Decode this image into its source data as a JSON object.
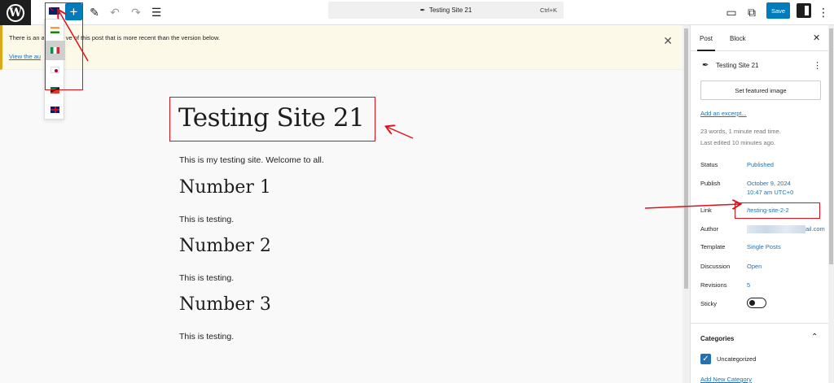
{
  "topbar": {
    "command_title": "Testing Site 21",
    "command_shortcut": "Ctrl+K",
    "save_label": "Save",
    "add_label": "+"
  },
  "notice": {
    "text_before": "There is an a",
    "text_after": "ve of this post that is more recent than the version below.",
    "link_text": "View the au"
  },
  "post": {
    "title": "Testing Site 21",
    "intro": "This is my testing site. Welcome to all.",
    "headings": [
      "Number 1",
      "Number 2",
      "Number 3"
    ],
    "paragraphs": [
      "This is testing.",
      "This is testing.",
      "This is testing."
    ]
  },
  "sidebar": {
    "tab_post": "Post",
    "tab_block": "Block",
    "post_title": "Testing Site 21",
    "featured_image_label": "Set featured image",
    "excerpt_link": "Add an excerpt...",
    "read_time": "23 words, 1 minute read time.",
    "last_edited": "Last edited 10 minutes ago.",
    "status_label": "Status",
    "status_value": "Published",
    "publish_label": "Publish",
    "publish_date": "October 9, 2024",
    "publish_time": "10:47 am UTC+0",
    "link_label": "Link",
    "link_value": "/testing-site-2-2",
    "author_label": "Author",
    "author_suffix": "ail.com",
    "template_label": "Template",
    "template_value": "Single Posts",
    "discussion_label": "Discussion",
    "discussion_value": "Open",
    "revisions_label": "Revisions",
    "revisions_value": "5",
    "sticky_label": "Sticky",
    "categories_label": "Categories",
    "category_item": "Uncategorized",
    "add_category_link": "Add New Category"
  },
  "language_menu": {
    "items": [
      "flag-india-icon",
      "flag-italy-icon",
      "flag-japan-icon",
      "flag-south-africa-icon",
      "flag-uk-icon"
    ],
    "selected_index": 1
  },
  "colors": {
    "accent": "#007cba",
    "annotation": "#e0101a",
    "notice_bg": "#fcf9e8"
  }
}
